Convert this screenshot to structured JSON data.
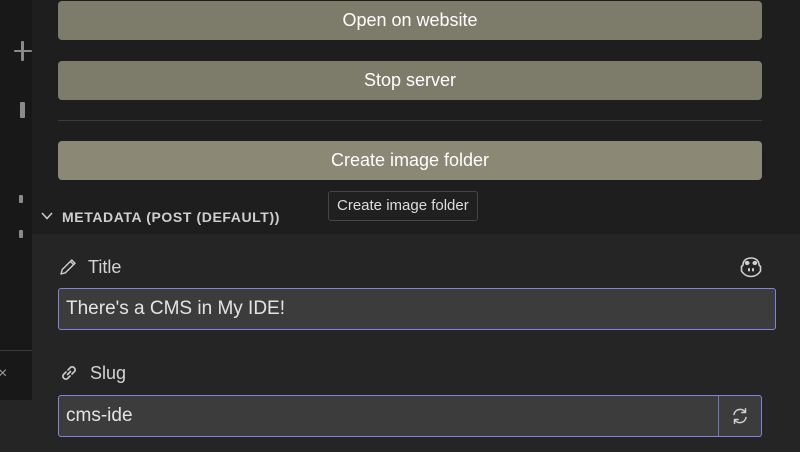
{
  "actions": {
    "open_website_label": "Open on website",
    "stop_server_label": "Stop server",
    "create_image_folder_label": "Create image folder"
  },
  "tooltip": {
    "text": "Create image folder"
  },
  "metadata_section": {
    "header": "METADATA (POST (DEFAULT))",
    "fields": {
      "title": {
        "label": "Title",
        "value": "There's a CMS in My IDE!"
      },
      "slug": {
        "label": "Slug",
        "value": "cms-ide"
      }
    }
  },
  "colors": {
    "button_bg": "#7d7c6a",
    "button_hover_bg": "#8b8875",
    "input_focus_border": "#7b86d6",
    "panel_bg": "#1e1e1e"
  },
  "icons": [
    "pencil-icon",
    "link-icon",
    "copilot-icon",
    "refresh-icon",
    "chevron-down-icon",
    "close-icon"
  ]
}
